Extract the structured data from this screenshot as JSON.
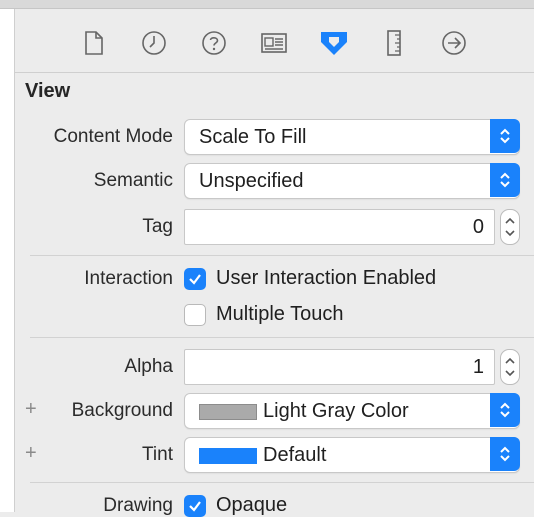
{
  "inspector_tabs": [
    {
      "name": "file-inspector-icon"
    },
    {
      "name": "history-inspector-icon"
    },
    {
      "name": "quick-help-icon"
    },
    {
      "name": "identity-inspector-icon"
    },
    {
      "name": "attributes-inspector-icon",
      "active": true
    },
    {
      "name": "size-inspector-icon"
    },
    {
      "name": "connections-inspector-icon"
    }
  ],
  "section": {
    "title": "View"
  },
  "content_mode": {
    "label": "Content Mode",
    "value": "Scale To Fill"
  },
  "semantic": {
    "label": "Semantic",
    "value": "Unspecified"
  },
  "tag": {
    "label": "Tag",
    "value": "0"
  },
  "interaction": {
    "label": "Interaction",
    "user_interaction": {
      "label": "User Interaction Enabled",
      "checked": true
    },
    "multiple_touch": {
      "label": "Multiple Touch",
      "checked": false
    }
  },
  "alpha": {
    "label": "Alpha",
    "value": "1"
  },
  "background": {
    "label": "Background",
    "value": "Light Gray Color",
    "swatch_color": "#aaaaaa"
  },
  "tint": {
    "label": "Tint",
    "value": "Default",
    "swatch_color": "#1a82fb"
  },
  "drawing": {
    "label": "Drawing",
    "opaque": {
      "label": "Opaque",
      "checked": true
    }
  },
  "colors": {
    "accent": "#1a82fb"
  }
}
